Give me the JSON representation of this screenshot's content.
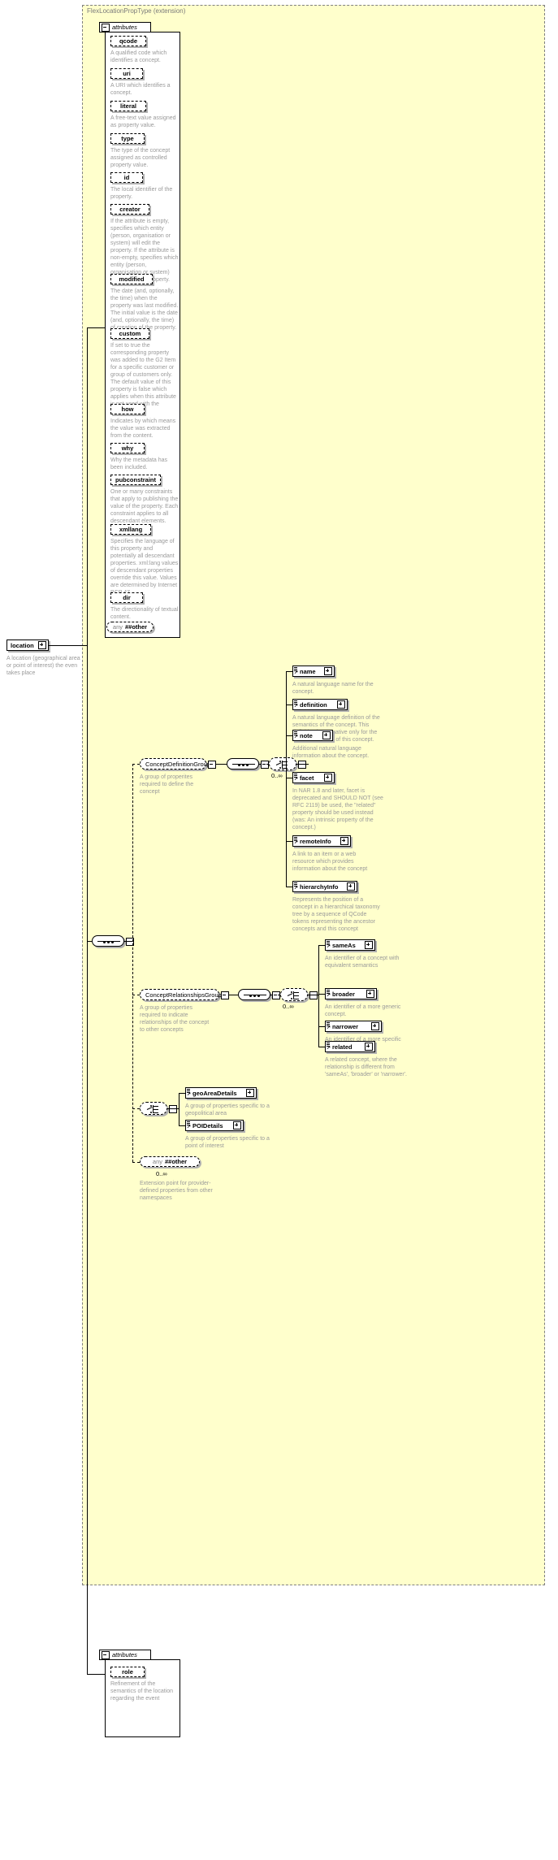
{
  "diagram": {
    "extension_title": "FlexLocationPropType (extension)",
    "attributes_label": "attributes",
    "root_element": {
      "name": "location",
      "desc": "A location (geographical area or point of interest) the even takes place"
    }
  },
  "attributes": [
    {
      "name": "qcode",
      "desc": "A qualified code which identifies a concept."
    },
    {
      "name": "uri",
      "desc": "A URI which identifies a concept."
    },
    {
      "name": "literal",
      "desc": "A free-text value assigned as property value."
    },
    {
      "name": "type",
      "desc": "The type of the concept assigned as controlled property value."
    },
    {
      "name": "id",
      "desc": "The local identifier of the property."
    },
    {
      "name": "creator",
      "desc": "If the attribute is empty, specifies which entity (person, organisation or system) will edit the property. If the attribute is non-empty, specifies which entity (person, organisation or system) has edited the property."
    },
    {
      "name": "modified",
      "desc": "The date (and, optionally, the time) when the property was last modified. The initial value is the date (and, optionally, the time) of creation of the property."
    },
    {
      "name": "custom",
      "desc": "If set to true the corresponding property was added to the G2 Item for a specific customer or group of customers only. The default value of this property is false which applies when this attribute is not used with the property."
    },
    {
      "name": "how",
      "desc": "Indicates by which means the value was extracted from the content."
    },
    {
      "name": "why",
      "desc": "Why the metadata has been included."
    },
    {
      "name": "pubconstraint",
      "desc": "One or many constraints that apply to publishing the value of the property. Each constraint applies to all descendant elements."
    },
    {
      "name": "xmllang",
      "desc": "Specifies the language of this property and potentially all descendant properties. xml:lang values of descendant properties override this value. Values are determined by Internet BCP 47."
    },
    {
      "name": "dir",
      "desc": "The directionality of textual content."
    }
  ],
  "attributes_any": {
    "keyword": "any",
    "namespace": "##other"
  },
  "groups": [
    {
      "name": "ConceptDefinitionGroup",
      "desc": "A group of properites required to define the concept",
      "cardinality": "0..∞",
      "children": [
        {
          "name": "name",
          "desc": "A natural language name for the concept."
        },
        {
          "name": "definition",
          "desc": "A natural language definition of the semantics of the concept. This definition is normative only for the scope of the use of this concept."
        },
        {
          "name": "note",
          "desc": "Additional natural language information about the concept."
        },
        {
          "name": "facet",
          "desc": "In NAR 1.8 and later, facet is deprecated and SHOULD NOT (see RFC 2119) be used, the \"related\" property should be used instead (was: An intrinsic property of the concept.)"
        },
        {
          "name": "remoteInfo",
          "desc": "A link to an item or a web resource which provides information about the concept"
        },
        {
          "name": "hierarchyInfo",
          "desc": "Represents the position of a concept in a hierarchical taxonomy tree by a sequence of QCode tokens representing the ancestor concepts and this concept"
        }
      ]
    },
    {
      "name": "ConceptRelationshipsGroup",
      "desc": "A group of properties required to indicate relationships of the concept to other concepts",
      "cardinality": "0..∞",
      "children": [
        {
          "name": "sameAs",
          "desc": "An identifier of a concept with equivalent semantics"
        },
        {
          "name": "broader",
          "desc": "An identifier of a more generic concept."
        },
        {
          "name": "narrower",
          "desc": "An identifier of a more specific concept."
        },
        {
          "name": "related",
          "desc": "A related concept, where the relationship is different from 'sameAs', 'broader' or 'narrower'."
        }
      ]
    }
  ],
  "detail_choice": {
    "children": [
      {
        "name": "geoAreaDetails",
        "desc": "A group of properties specific to a geopolitical area"
      },
      {
        "name": "POIDetails",
        "desc": "A group of properties specific to a point of interest"
      }
    ]
  },
  "body_any": {
    "keyword": "any",
    "namespace": "##other",
    "cardinality": "0..∞",
    "desc": "Extension point for provider-defined properties from other namespaces"
  },
  "bottom_attributes": {
    "label": "attributes",
    "items": [
      {
        "name": "role",
        "desc": "Refinement of the semantics of the location regarding the event"
      }
    ]
  }
}
